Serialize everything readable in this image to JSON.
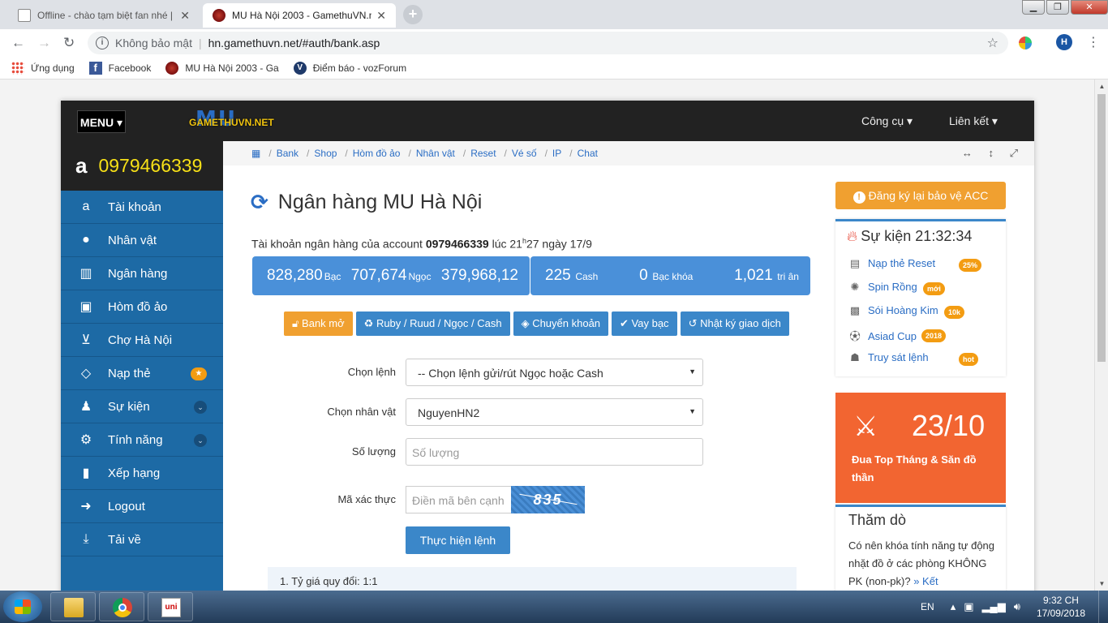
{
  "browser": {
    "tabs": [
      {
        "title": "Offline - chào tạm biệt fan nhé |"
      },
      {
        "title": "MU Hà Nội 2003 - GamethuVN.n"
      }
    ],
    "window_controls": {
      "minimize": "▁",
      "maximize": "❐",
      "close": "✕"
    },
    "address": {
      "security": "Không bảo mật",
      "url": "hn.gamethuvn.net/#auth/bank.asp"
    },
    "profile_initial": "H",
    "bookmarks": [
      "Ứng dụng",
      "Facebook",
      "MU Hà Nội 2003 - Ga",
      "Điểm báo - vozForum"
    ]
  },
  "site": {
    "menu_label": "MENU ▾",
    "logo": {
      "big": "MU",
      "text": "GAMETHUVN.NET"
    },
    "top_links": [
      "Công cụ ▾",
      "Liên kết ▾"
    ],
    "account_id": "0979466339",
    "sidebar": [
      {
        "label": "Tài khoản",
        "icon": "amazon-icon"
      },
      {
        "label": "Nhân vật",
        "icon": "user-icon"
      },
      {
        "label": "Ngân hàng",
        "icon": "bank-icon"
      },
      {
        "label": "Hòm đồ ảo",
        "icon": "briefcase-icon"
      },
      {
        "label": "Chợ Hà Nội",
        "icon": "cart-icon"
      },
      {
        "label": "Nạp thẻ",
        "icon": "diamond-icon",
        "badge": "★"
      },
      {
        "label": "Sự kiện",
        "icon": "android-icon",
        "chev": "⌄"
      },
      {
        "label": "Tính năng",
        "icon": "cogs-icon",
        "chev": "⌄"
      },
      {
        "label": "Xếp hạng",
        "icon": "chart-icon"
      },
      {
        "label": "Logout",
        "icon": "signout-icon"
      },
      {
        "label": "Tải về",
        "icon": "download-icon"
      }
    ],
    "breadcrumbs": [
      "Bank",
      "Shop",
      "Hòm đồ ảo",
      "Nhân vật",
      "Reset",
      "Vé số",
      "IP",
      "Chat"
    ]
  },
  "main": {
    "title": "Ngân hàng MU Hà Nội",
    "account_line": {
      "prefix": "Tài khoản ngân hàng của account",
      "account": "0979466339",
      "mid": "lúc 21",
      "sup": "h",
      "suffix": "27 ngày 17/9"
    },
    "stats_left": [
      {
        "value": "828,280",
        "unit": "Bạc"
      },
      {
        "value": "707,674",
        "unit": "Ngọc"
      },
      {
        "value": "379,968,12",
        "unit": ""
      }
    ],
    "stats_right": [
      {
        "value": "225",
        "unit": "Cash"
      },
      {
        "value": "0",
        "unit": "Bạc khóa"
      },
      {
        "value": "1,021",
        "unit": "tri ân"
      }
    ],
    "actions": [
      "Bank mở",
      "Ruby / Ruud / Ngọc / Cash",
      "Chuyển khoản",
      "Vay bạc",
      "Nhật ký giao dịch"
    ],
    "form": {
      "command_label": "Chọn lệnh",
      "command_value": "-- Chọn lệnh gửi/rút Ngọc hoặc Cash",
      "char_label": "Chọn nhân vật",
      "char_value": "NguyenHN2",
      "qty_label": "Số lượng",
      "qty_placeholder": "Số lượng",
      "captcha_label": "Mã xác thực",
      "captcha_placeholder": "Điền mã bên cạnh",
      "captcha_code": "835",
      "submit": "Thực hiện lệnh"
    },
    "note": "1. Tỷ giá quy đổi: 1:1"
  },
  "right": {
    "register": "Đăng ký lại bảo vệ ACC",
    "event_title": "Sự kiện 21:32:34",
    "events": [
      {
        "label": "Nạp thẻ Reset",
        "badge": "25%"
      },
      {
        "label": "Spin Rồng",
        "badge": "mới"
      },
      {
        "label": "Sói Hoàng Kim",
        "badge": "10k"
      },
      {
        "label": "Asiad Cup",
        "badge": "2018"
      },
      {
        "label": "Truy sát lệnh",
        "badge": "hot"
      }
    ],
    "promo": {
      "date": "23/10",
      "desc": "Đua Top Tháng & Săn đồ thần"
    },
    "poll": {
      "title": "Thăm dò",
      "question": "Có nên khóa tính năng tự động nhặt đồ ở các phòng KHÔNG PK (non-pk)?",
      "link": "» Kết"
    }
  },
  "taskbar": {
    "lang": "EN",
    "time": "9:32 CH",
    "date": "17/09/2018"
  }
}
